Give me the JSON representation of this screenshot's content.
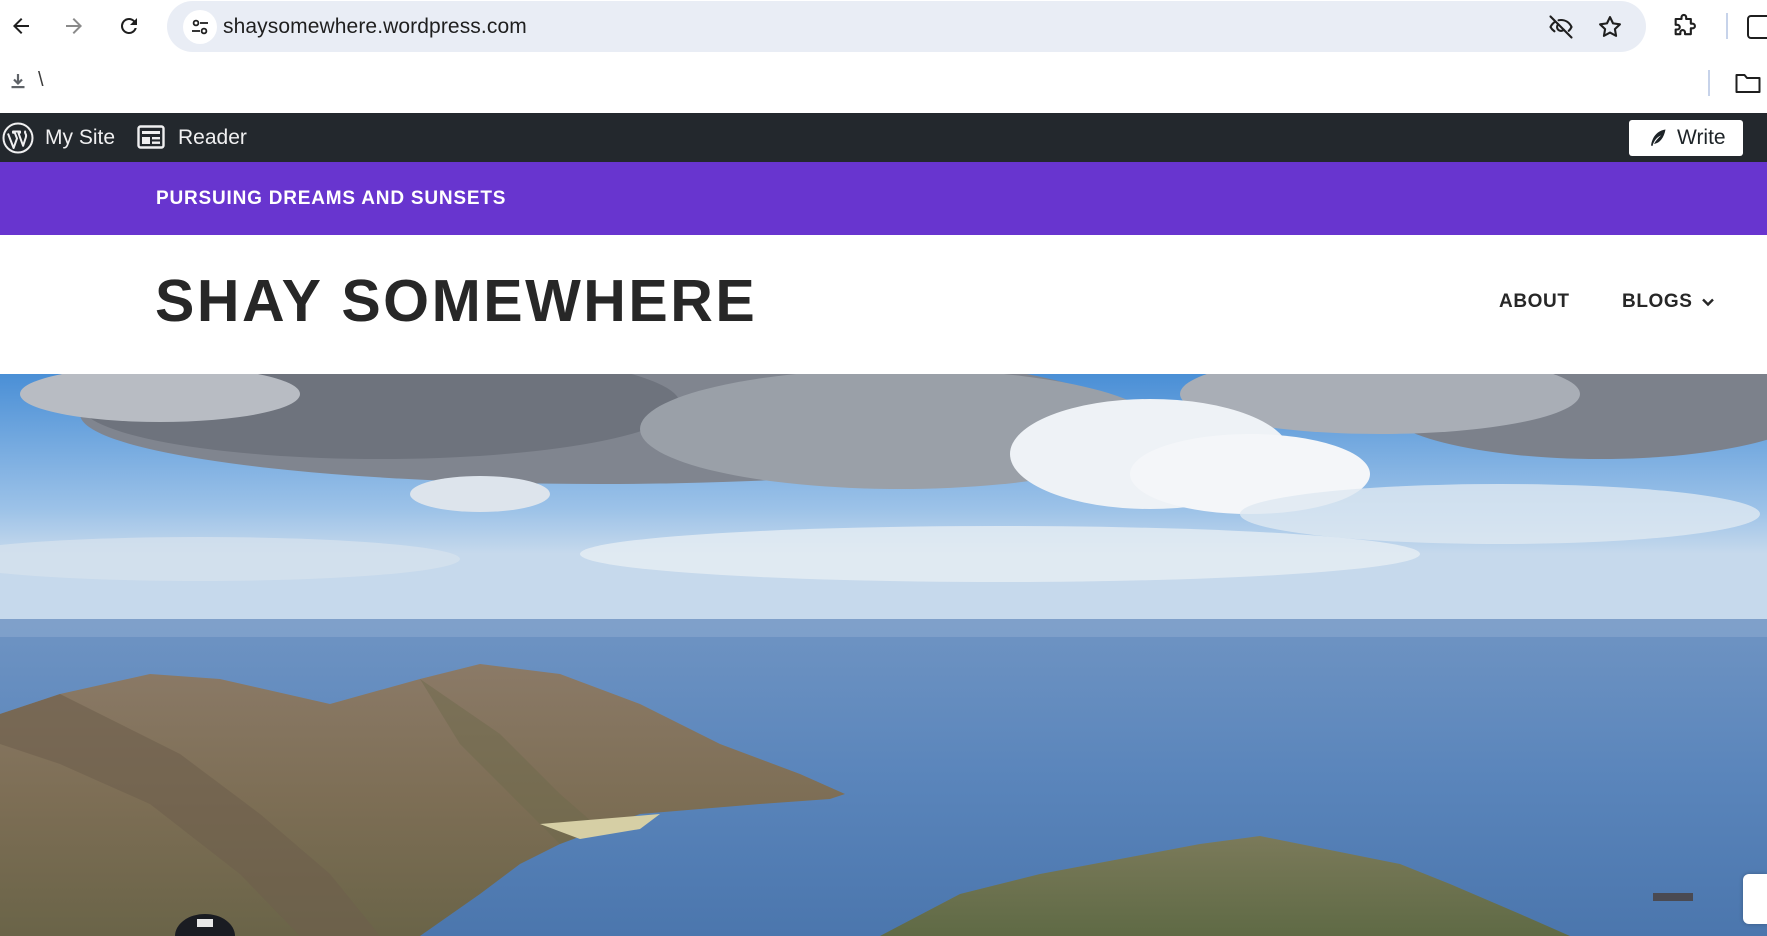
{
  "browser": {
    "url": "shaysomewhere.wordpress.com",
    "bookmarks_item": "\\"
  },
  "admin_bar": {
    "my_site": "My Site",
    "reader": "Reader",
    "write": "Write"
  },
  "site": {
    "tagline": "PURSUING DREAMS AND SUNSETS",
    "title": "SHAY SOMEWHERE",
    "nav": {
      "about": "ABOUT",
      "blogs": "BLOGS"
    }
  },
  "colors": {
    "accent_purple": "#6835cf",
    "admin_bar": "#23282d",
    "omnibox": "#e9edf5"
  },
  "icons": [
    "back-arrow-icon",
    "forward-arrow-icon",
    "reload-icon",
    "site-settings-icon",
    "eye-off-icon",
    "star-icon",
    "extensions-icon",
    "side-panel-icon",
    "download-icon",
    "folder-icon",
    "wordpress-logo-icon",
    "reader-icon",
    "pen-icon",
    "chevron-down-icon"
  ]
}
